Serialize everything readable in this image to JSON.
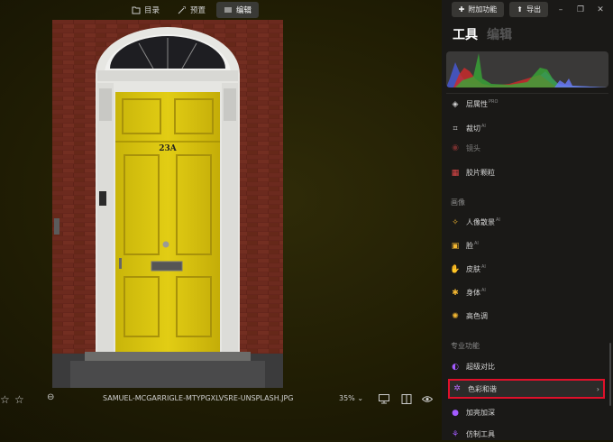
{
  "toolbar": {
    "tabs": [
      {
        "label": "目录",
        "icon": "folder-icon"
      },
      {
        "label": "预置",
        "icon": "magic-wand-icon"
      },
      {
        "label": "编辑",
        "icon": "sliders-icon"
      }
    ]
  },
  "photo": {
    "house_number": "23A"
  },
  "bottombar": {
    "filename": "SAMUEL-MCGARRIGLE-MTYPGXLVSRE-UNSPLASH.JPG",
    "zoom": "35%"
  },
  "panel": {
    "add_feature_label": "附加功能",
    "export_label": "导出",
    "tabs": {
      "tools": "工具",
      "edit": "编辑"
    },
    "items_top": [
      {
        "label": "层属性",
        "badge": "PRO",
        "icon": "layers-icon"
      },
      {
        "label": "裁切",
        "badge": "AI",
        "icon": "crop-icon"
      },
      {
        "label": "镜头",
        "badge": "",
        "icon": "lens-icon"
      },
      {
        "label": "胶片颗粒",
        "badge": "",
        "icon": "film-grain-icon"
      }
    ],
    "section_portrait": "画像",
    "items_portrait": [
      {
        "label": "人像散景",
        "badge": "AI",
        "icon": "portrait-bokeh-icon"
      },
      {
        "label": "脸",
        "badge": "AI",
        "icon": "face-icon"
      },
      {
        "label": "皮肤",
        "badge": "AI",
        "icon": "skin-icon"
      },
      {
        "label": "身体",
        "badge": "AI",
        "icon": "body-icon"
      },
      {
        "label": "高色调",
        "badge": "",
        "icon": "high-key-icon"
      }
    ],
    "section_pro": "专业功能",
    "items_pro": [
      {
        "label": "超级对比",
        "badge": "",
        "icon": "contrast-icon"
      },
      {
        "label": "色彩和谐",
        "badge": "",
        "icon": "color-harmony-icon"
      },
      {
        "label": "加亮加深",
        "badge": "",
        "icon": "dodge-burn-icon"
      },
      {
        "label": "仿制工具",
        "badge": "",
        "icon": "clone-icon"
      }
    ]
  }
}
